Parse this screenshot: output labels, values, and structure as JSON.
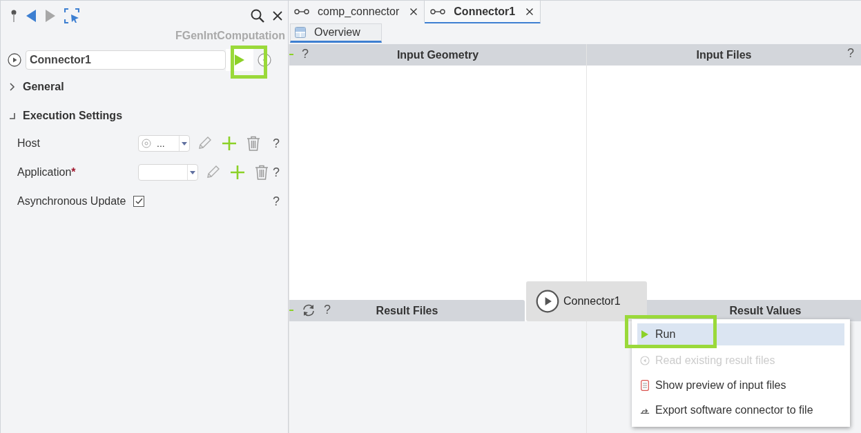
{
  "component_type": "FGenIntComputation",
  "name_field": {
    "value": "Connector1"
  },
  "run_button": {
    "highlighted": true
  },
  "sections": [
    {
      "title": "General",
      "expanded": false
    },
    {
      "title": "Execution Settings",
      "expanded": true,
      "rows": [
        {
          "kind": "combo",
          "label": "Host",
          "value": "...",
          "help": "?"
        },
        {
          "kind": "combo",
          "label": "Application",
          "required_mark": "*",
          "help": "?"
        },
        {
          "kind": "checkbox",
          "label": "Asynchronous Update",
          "checked": true,
          "help": "?"
        }
      ]
    }
  ],
  "editor_tabs": [
    {
      "label": "comp_connector",
      "selected": false
    },
    {
      "label": "Connector1",
      "selected": true
    }
  ],
  "page_tabs": [
    {
      "label": "Overview",
      "selected": true
    }
  ],
  "panels": [
    {
      "title": "Input Geometry",
      "help": "?",
      "dash": true,
      "refresh": false
    },
    {
      "title": "Input Files",
      "help": "?",
      "dash": false,
      "refresh": false
    },
    {
      "title": "Result Files",
      "help": "?",
      "dash": true,
      "refresh": true
    },
    {
      "title": "Result Values",
      "dash": false,
      "refresh": false
    }
  ],
  "drag_chip": {
    "label": "Connector1"
  },
  "context_menu": [
    {
      "kind": "run",
      "label": "Run",
      "selected": true,
      "disabled": false,
      "highlighted": true
    },
    {
      "kind": "read",
      "label": "Read existing result files",
      "selected": false,
      "disabled": true,
      "highlighted": false
    },
    {
      "kind": "preview",
      "label": "Show preview of input files",
      "selected": false,
      "disabled": false,
      "highlighted": false
    },
    {
      "kind": "export",
      "label": "Export software connector to file",
      "selected": false,
      "disabled": false,
      "highlighted": false
    }
  ]
}
